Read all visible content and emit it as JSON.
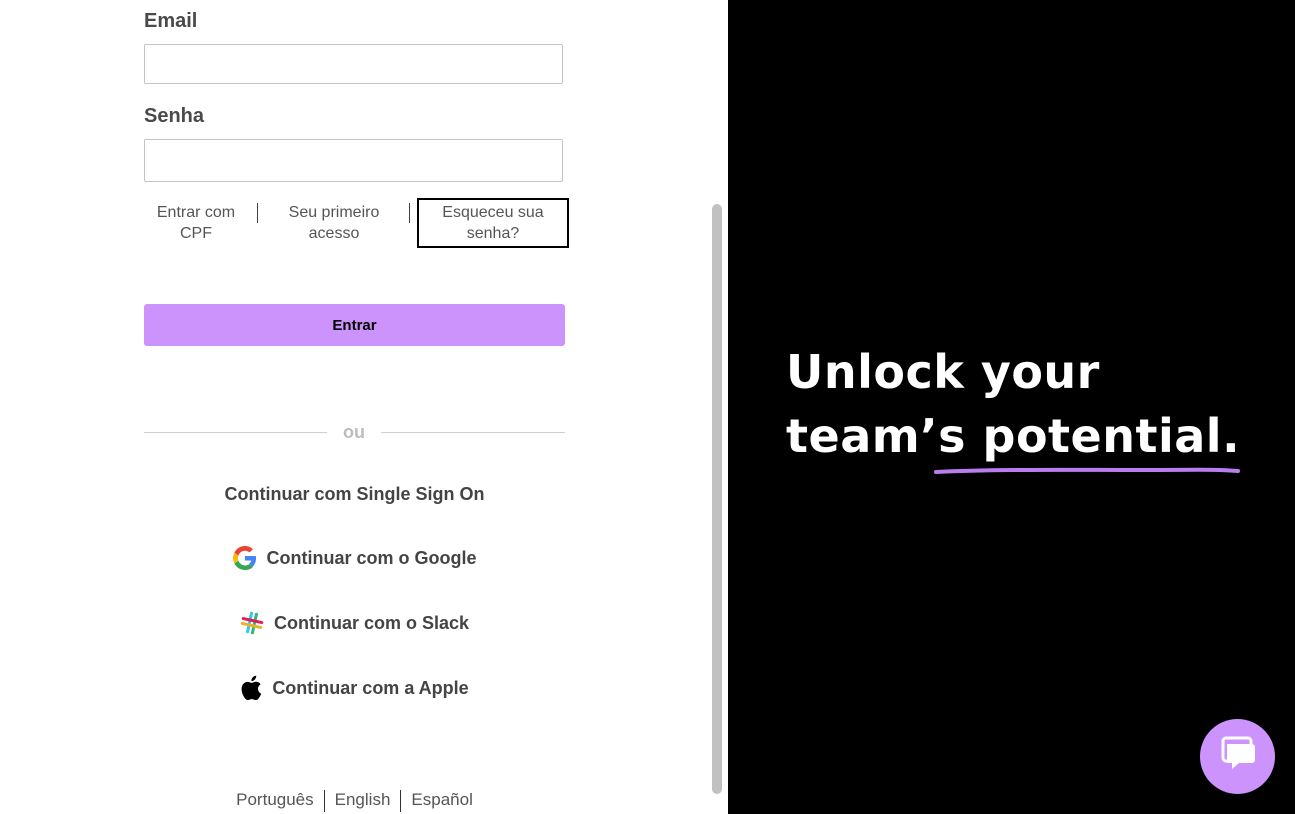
{
  "form": {
    "email_label": "Email",
    "email_value": "",
    "password_label": "Senha",
    "password_value": "",
    "submit_label": "Entrar"
  },
  "auth_links": {
    "cpf": "Entrar com CPF",
    "first_access": "Seu primeiro acesso",
    "forgot": "Esqueceu sua senha?"
  },
  "divider_text": "ou",
  "sso_options": {
    "single_sign_on": "Continuar com Single Sign On",
    "google": "Continuar com o Google",
    "slack": "Continuar com o Slack",
    "apple": "Continuar com a Apple"
  },
  "languages": [
    "Português",
    "English",
    "Español"
  ],
  "promo": {
    "line1": "Unlock your",
    "line2_part1": "team’s ",
    "line2_part2": "potential."
  },
  "colors": {
    "accent": "#cd93fd",
    "promo_bg": "#000000"
  },
  "icons": {
    "chat": "chat-bubble-icon",
    "google": "google-icon",
    "slack": "slack-icon",
    "apple": "apple-icon"
  }
}
